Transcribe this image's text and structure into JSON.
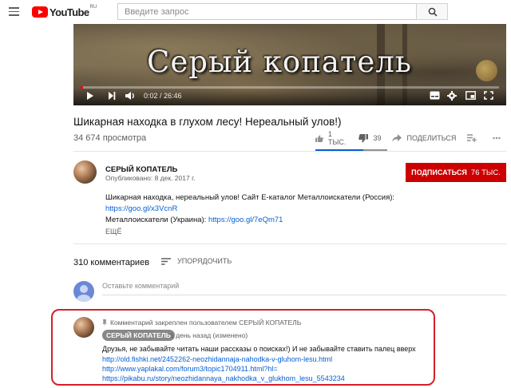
{
  "masthead": {
    "logo_text": "YouTube",
    "logo_region": "RU",
    "search_placeholder": "Введите запрос"
  },
  "player": {
    "title_overlay": "Серый копатель",
    "time": "0:02 / 26:46",
    "progress_fraction": 0.0012
  },
  "video": {
    "title": "Шикарная находка в глухом лесу! Нереальный улов!)",
    "views": "34 674 просмотра",
    "likes": "1 ТЫС.",
    "dislikes": "39",
    "share_label": "ПОДЕЛИТЬСЯ"
  },
  "channel": {
    "name": "СЕРЫЙ КОПАТЕЛЬ",
    "published": "Опубликовано: 8 дек. 2017 г.",
    "subscribe_label": "ПОДПИСАТЬСЯ",
    "subscriber_count": "76 ТЫС."
  },
  "description": {
    "line1": "Шикарная находка, нереальный улов! Сайт Е-каталог Металлоискатели (Россия):",
    "link1": "https://goo.gl/x3VcnR",
    "line2_text": "Металлоискатели (Украина): ",
    "link2": "https://goo.gl/7eQm71",
    "more_label": "ЕЩЁ"
  },
  "comments": {
    "count": "310 комментариев",
    "sort_label": "УПОРЯДОЧИТЬ",
    "add_placeholder": "Оставьте комментарий",
    "pinned_comment": {
      "pinned_note": "Комментарий закреплен пользователем СЕРЫЙ КОПАТЕЛЬ",
      "author": "СЕРЫЙ КОПАТЕЛЬ",
      "time": "1 день назад (изменено)",
      "text": "Друзья, не забывайте читать наши рассказы  о поисках!) И не забывайте ставить палец вверх",
      "links": [
        "http://old.fishki.net/2452262-neozhidannaja-nahodka-v-gluhom-lesu.html",
        "http://www.yaplakal.com/forum3/topic1704911.html?hl=",
        "https://pikabu.ru/story/neozhidannaya_nakhodka_v_glukhom_lesu_5543234"
      ]
    }
  },
  "colors": {
    "brand_red": "#ff0000",
    "subscribe_red": "#cc0000",
    "link_blue": "#065fd4",
    "highlight_red": "#d3202a"
  },
  "icons": [
    "menu-icon",
    "search-icon",
    "play-icon",
    "next-icon",
    "volume-icon",
    "subtitles-icon",
    "settings-icon",
    "miniplayer-icon",
    "fullscreen-icon",
    "like-icon",
    "dislike-icon",
    "share-icon",
    "add-to-playlist-icon",
    "sort-icon",
    "pin-icon"
  ]
}
